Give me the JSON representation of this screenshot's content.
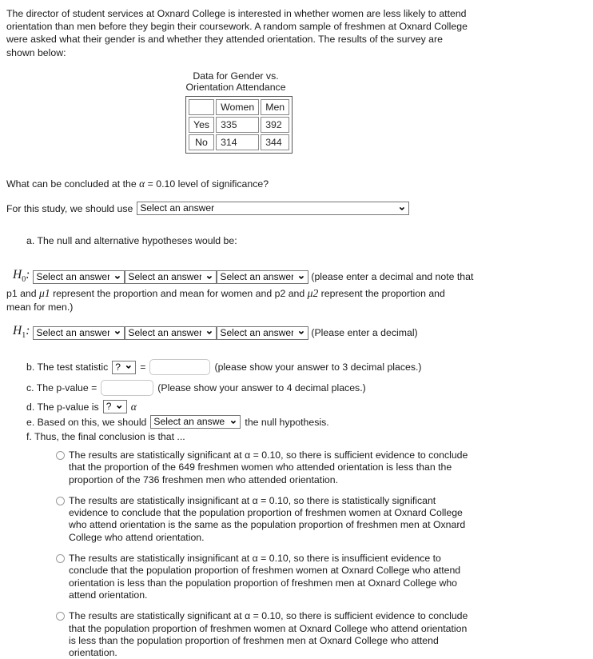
{
  "intro": {
    "paragraph": "The director of student services at Oxnard College is interested in whether women are less likely to attend orientation than men before they begin their coursework.  A random sample of freshmen at Oxnard College were asked what their gender is and whether they attended orientation.  The results of the survey are shown below:"
  },
  "table": {
    "caption": "Data for Gender vs. Orientation Attendance",
    "corner": "",
    "columns": [
      "Women",
      "Men"
    ],
    "rows": [
      {
        "label": "Yes",
        "women": "335",
        "men": "392"
      },
      {
        "label": "No",
        "women": "314",
        "men": "344"
      }
    ]
  },
  "question": {
    "alpha_line_pre": "What can be concluded at the ",
    "alpha_symbol": "α",
    "alpha_line_post": " = 0.10 level of significance?",
    "use_label": "For this study, we should use",
    "select_placeholder": "Select an answer"
  },
  "part_a": {
    "label": "a. The null and alternative hypotheses would be:",
    "h0_label": "H",
    "h0_sub": "0",
    "h1_label": "H",
    "h1_sub": "1",
    "colon": ":",
    "h0_note": "(please enter a decimal and note that",
    "h0_tail_1": "p1 and ",
    "h0_mu1": "μ1",
    "h0_tail_2": " represent the proportion and mean for women and p2 and ",
    "h0_mu2": "μ2",
    "h0_tail_3": " represent the proportion and mean for men.)",
    "h1_note": "(Please enter a decimal)",
    "select_placeholder": "Select an answer"
  },
  "part_b": {
    "label": "b. The test statistic",
    "stat_select": "?",
    "equals": "=",
    "value": "",
    "note": "(please show your answer to 3 decimal places.)"
  },
  "part_c": {
    "label": "c. The p-value =",
    "value": "",
    "note": "(Please show your answer to 4 decimal places.)"
  },
  "part_d": {
    "label": "d. The p-value is",
    "compare_select": "?",
    "alpha_symbol": "α"
  },
  "part_e": {
    "label_pre": "e. Based on this, we should",
    "select_placeholder": "Select an answer",
    "label_post": "the null hypothesis."
  },
  "part_f": {
    "label": "f. Thus, the final conclusion is that ...",
    "options": [
      "The results are statistically significant at α = 0.10, so there is sufficient evidence to conclude that the proportion of the 649 freshmen women who attended orientation is less than the proportion of the 736 freshmen men who attended orientation.",
      "The results are statistically insignificant at α = 0.10, so there is statistically significant evidence to conclude that the population proportion of freshmen women at Oxnard College who attend orientation is the same as the population proportion of freshmen men at Oxnard College who attend orientation.",
      "The results are statistically insignificant at α = 0.10, so there is insufficient evidence to conclude that the population proportion of freshmen women at Oxnard College who attend orientation is less than the population proportion of freshmen men at Oxnard College who attend orientation.",
      "The results are statistically significant at α = 0.10, so there is sufficient evidence to conclude that the population proportion of freshmen women at Oxnard College who attend orientation is less than the population proportion of freshmen men at Oxnard College who attend orientation."
    ]
  },
  "colors": {
    "text": "#1a1a1a",
    "table_border": "#888888",
    "input_border": "#c8c8c8",
    "select_border": "#767676"
  }
}
